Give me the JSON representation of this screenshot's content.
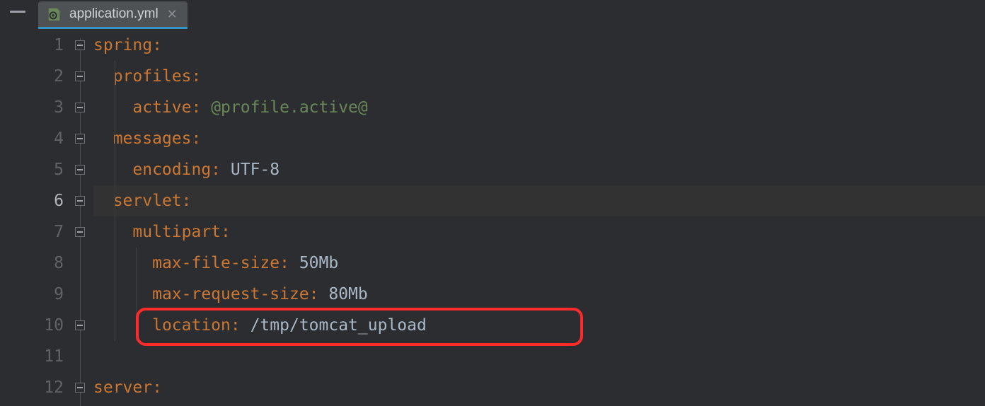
{
  "tab": {
    "filename": "application.yml"
  },
  "lines": {
    "l1": {
      "num": "1",
      "indent": 0,
      "key": "spring",
      "rest": ""
    },
    "l2": {
      "num": "2",
      "indent": 1,
      "key": "profiles",
      "rest": ""
    },
    "l3": {
      "num": "3",
      "indent": 2,
      "key": "active",
      "rest": " @profile.active@"
    },
    "l4": {
      "num": "4",
      "indent": 1,
      "key": "messages",
      "rest": ""
    },
    "l5": {
      "num": "5",
      "indent": 2,
      "key": "encoding",
      "rest": " UTF-8"
    },
    "l6": {
      "num": "6",
      "indent": 1,
      "key": "servlet",
      "rest": ""
    },
    "l7": {
      "num": "7",
      "indent": 2,
      "key": "multipart",
      "rest": ""
    },
    "l8": {
      "num": "8",
      "indent": 3,
      "key": "max-file-size",
      "rest": " 50Mb"
    },
    "l9": {
      "num": "9",
      "indent": 3,
      "key": "max-request-size",
      "rest": " 80Mb"
    },
    "l10": {
      "num": "10",
      "indent": 3,
      "key": "location",
      "rest": " /tmp/tomcat_upload"
    },
    "l11": {
      "num": "11",
      "indent": 0,
      "key": "",
      "rest": ""
    },
    "l12": {
      "num": "12",
      "indent": 0,
      "key": "server",
      "rest": ""
    }
  },
  "caret_line": 6,
  "highlighted_line": 10
}
